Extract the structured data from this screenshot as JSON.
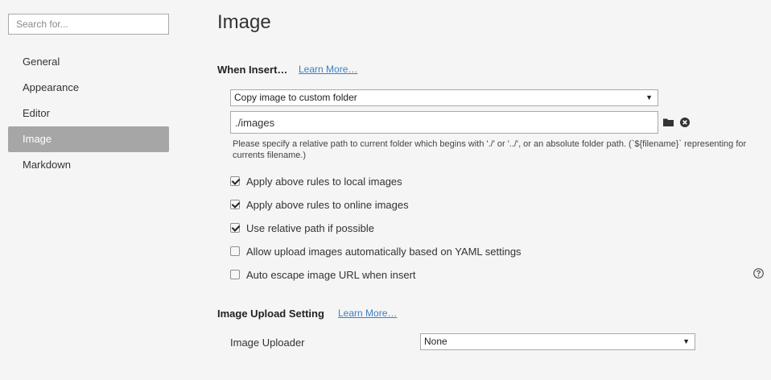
{
  "sidebar": {
    "search_placeholder": "Search for...",
    "items": [
      {
        "label": "General"
      },
      {
        "label": "Appearance"
      },
      {
        "label": "Editor"
      },
      {
        "label": "Image"
      },
      {
        "label": "Markdown"
      }
    ],
    "active_item": "Image"
  },
  "main": {
    "title": "Image",
    "when_insert": {
      "heading": "When Insert…",
      "learn_more": "Learn More…",
      "action_select": "Copy image to custom folder",
      "path_value": "./images",
      "hint": "Please specify a relative path to current folder which begins with './' or '../', or an absolute folder path. (`${filename}` representing for currents filename.)",
      "options": [
        {
          "label": "Apply above rules to local images",
          "checked": true
        },
        {
          "label": "Apply above rules to online images",
          "checked": true
        },
        {
          "label": "Use relative path if possible",
          "checked": true
        },
        {
          "label": "Allow upload images automatically based on YAML settings",
          "checked": false
        },
        {
          "label": "Auto escape image URL when insert",
          "checked": false
        }
      ]
    },
    "upload": {
      "heading": "Image Upload Setting",
      "learn_more": "Learn More…",
      "uploader_label": "Image Uploader",
      "uploader_value": "None"
    }
  },
  "icons": {
    "folder": "folder-icon",
    "clear": "close-circle-icon",
    "help": "help-circle-icon",
    "dropdown": "chevron-down-icon"
  },
  "colors": {
    "accent_link": "#3a80c4",
    "active_nav": "#a6a6a6",
    "background": "#f5f5f5"
  }
}
